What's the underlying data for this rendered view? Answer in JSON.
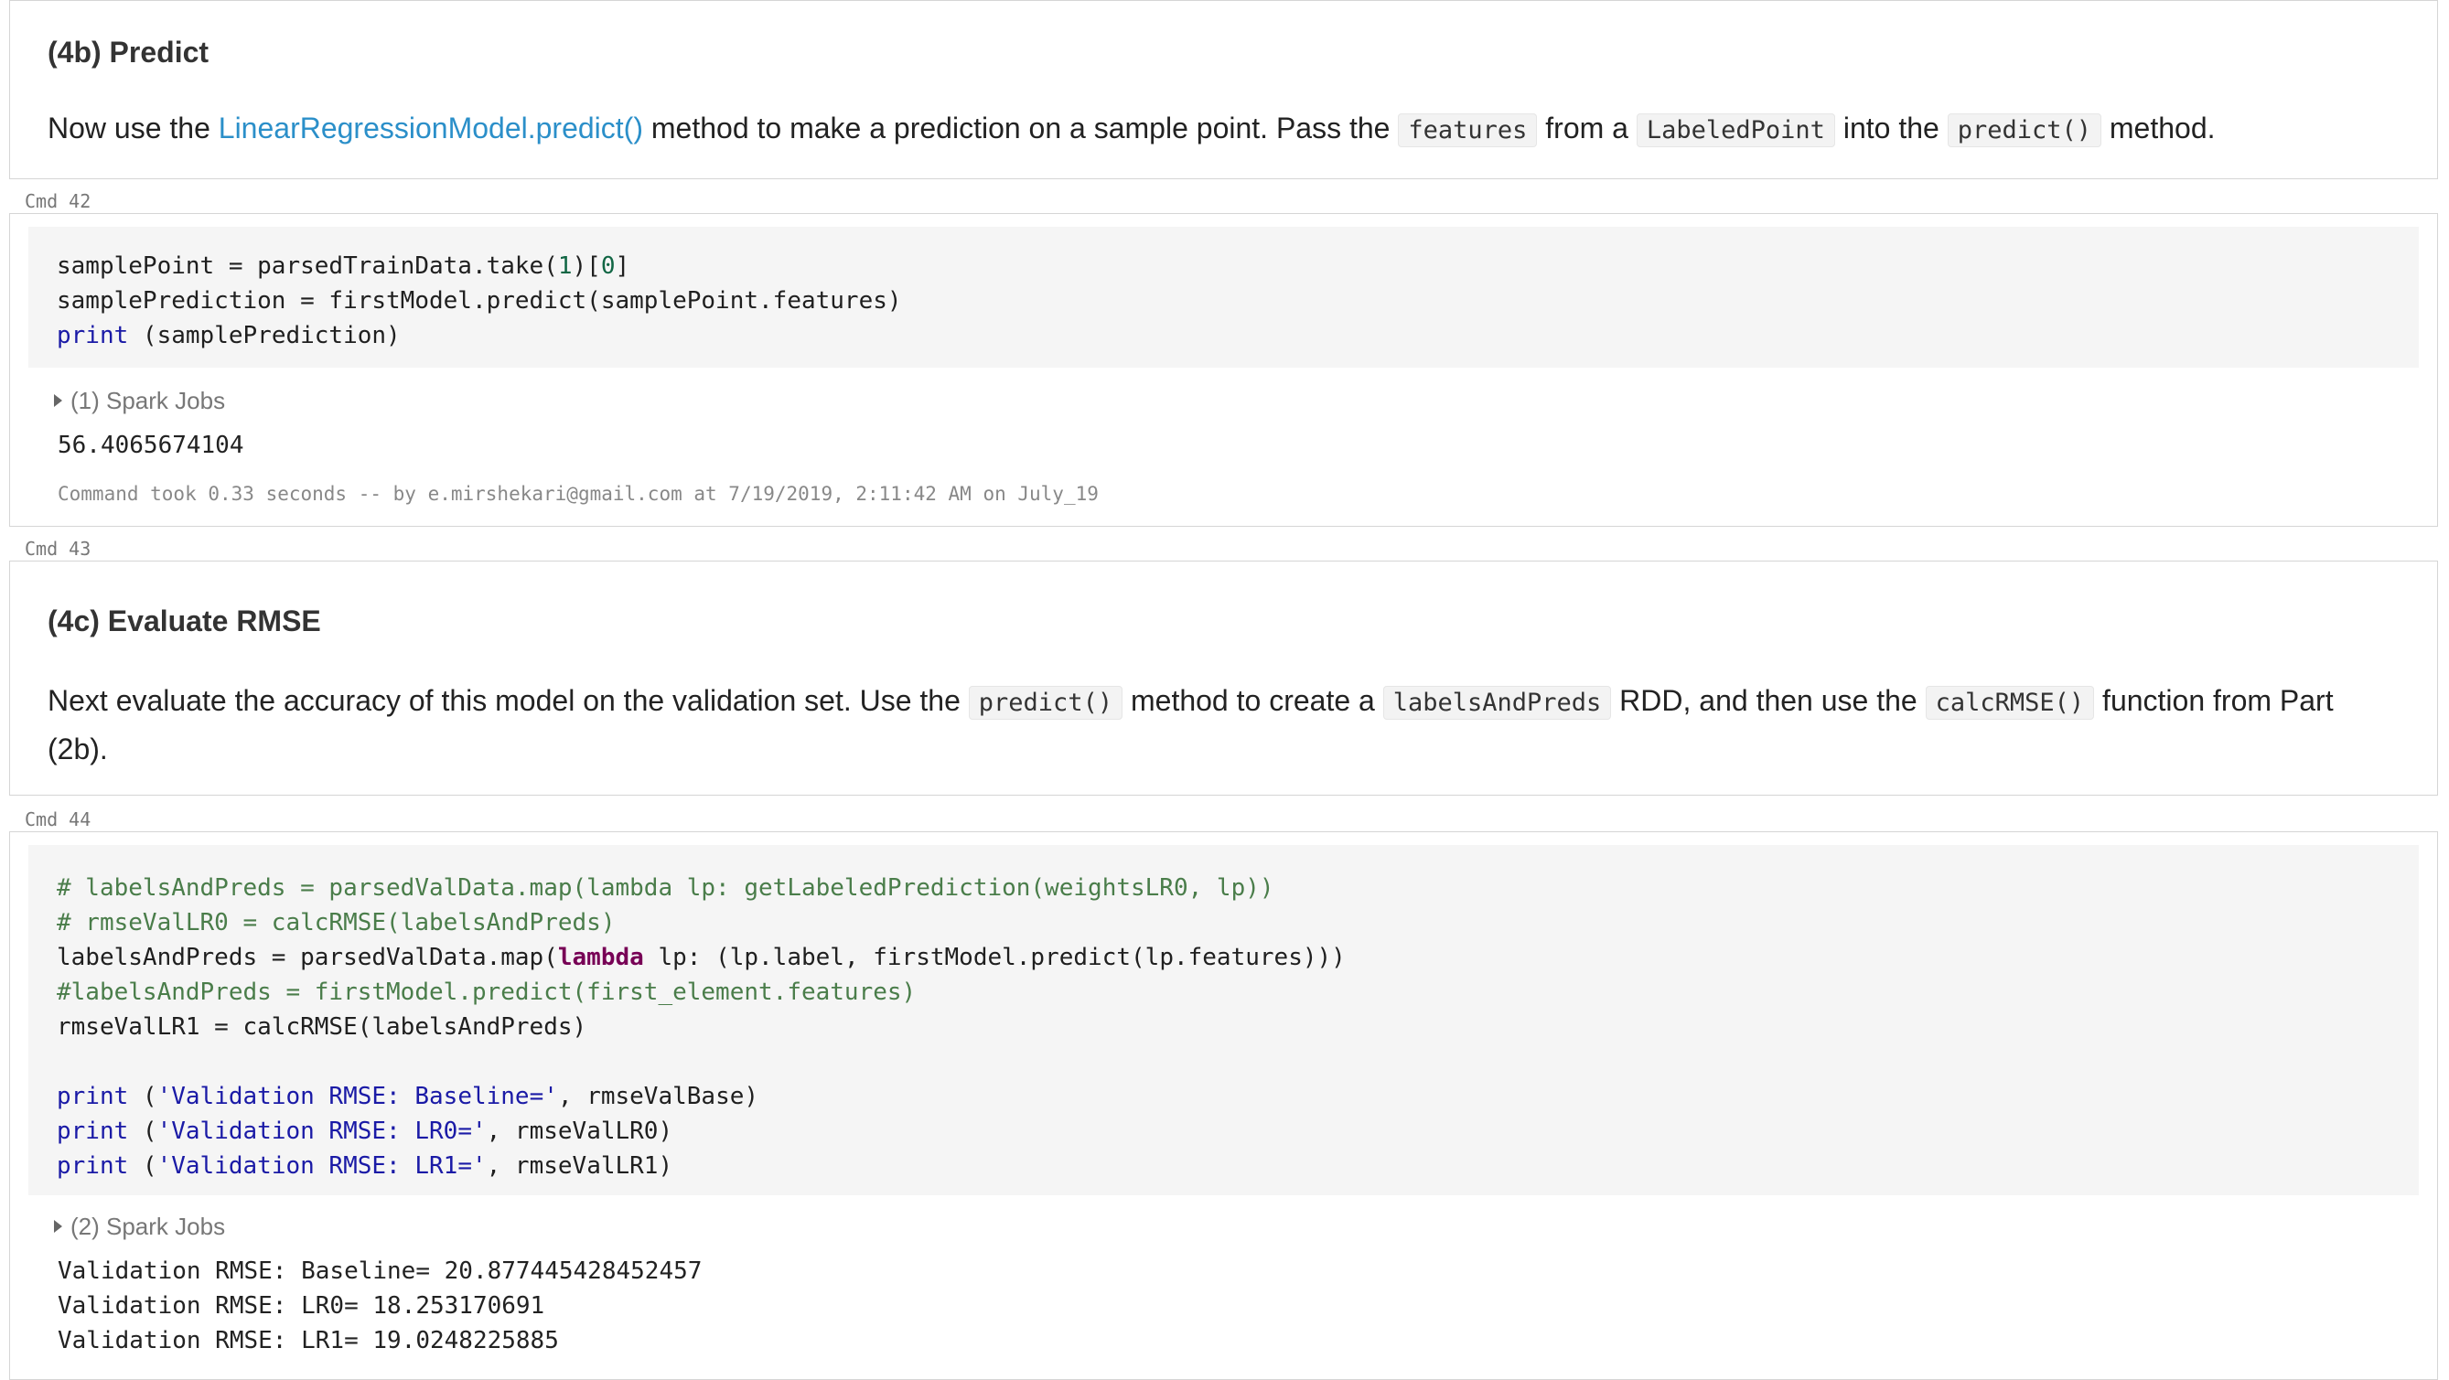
{
  "cell_4b": {
    "heading": "(4b) Predict",
    "para": {
      "t1": "Now use the ",
      "link": "LinearRegressionModel.predict()",
      "t2": " method to make a prediction on a sample point. Pass the ",
      "c1": "features",
      "t3": " from a ",
      "c2": "LabeledPoint",
      "t4": " into the ",
      "c3": "predict()",
      "t5": " method."
    }
  },
  "cmd42": {
    "label": "Cmd 42",
    "code": {
      "l1a": "samplePoint = parsedTrainData.take(",
      "l1n1": "1",
      "l1b": ")[",
      "l1n2": "0",
      "l1c": "]",
      "l2": "samplePrediction = firstModel.predict(samplePoint.features)",
      "l3kw": "print",
      "l3": " (samplePrediction)"
    },
    "spark_jobs": "(1) Spark Jobs",
    "output": "56.4065674104",
    "command_took": "Command took 0.33 seconds -- by e.mirshekari@gmail.com at 7/19/2019, 2:11:42 AM on July_19"
  },
  "cmd43": {
    "label": "Cmd 43",
    "heading": "(4c) Evaluate RMSE",
    "para": {
      "t1": "Next evaluate the accuracy of this model on the validation set. Use the ",
      "c1": "predict()",
      "t2": " method to create a ",
      "c2": "labelsAndPreds",
      "t3": " RDD, and then use the ",
      "c3": "calcRMSE()",
      "t4": " function from Part (2b)."
    }
  },
  "cmd44": {
    "label": "Cmd 44",
    "code": {
      "l1": "# labelsAndPreds = parsedValData.map(lambda lp: getLabeledPrediction(weightsLR0, lp))",
      "l2": "# rmseValLR0 = calcRMSE(labelsAndPreds)",
      "l3a": "labelsAndPreds = parsedValData.map(",
      "l3kw": "lambda",
      "l3b": " lp: (lp.label, firstModel.predict(lp.features)))",
      "l4": "#labelsAndPreds = firstModel.predict(first_element.features)",
      "l5": "rmseValLR1 = calcRMSE(labelsAndPreds)",
      "print_kw": "print",
      "p1s": "'Validation RMSE: Baseline='",
      "p1v": ", rmseValBase)",
      "p2s": "'Validation RMSE: LR0='",
      "p2v": ", rmseValLR0)",
      "p3s": "'Validation RMSE: LR1='",
      "p3v": ", rmseValLR1)"
    },
    "spark_jobs": "(2) Spark Jobs",
    "output": [
      "Validation RMSE: Baseline= 20.877445428452457",
      "Validation RMSE: LR0= 18.253170691",
      "Validation RMSE: LR1= 19.0248225885"
    ]
  }
}
